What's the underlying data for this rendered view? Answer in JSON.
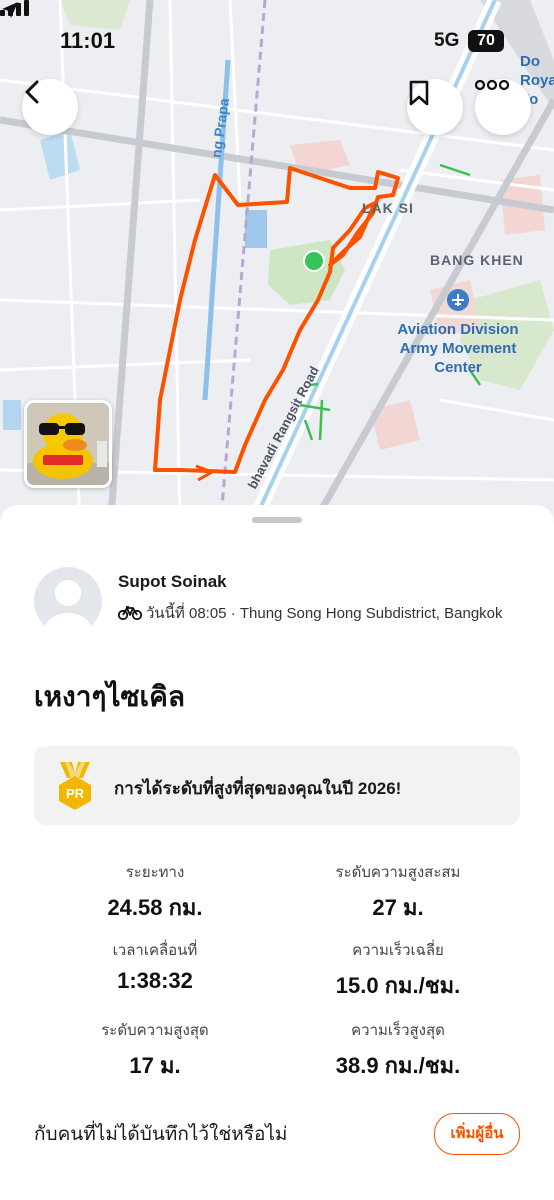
{
  "status_bar": {
    "time": "11:01",
    "network": "5G",
    "battery": "70"
  },
  "map": {
    "labels": {
      "lak_si": "LAK SI",
      "bang_khen": "BANG KHEN",
      "road_vibhavadi": "bhavadi Rangsit Road",
      "road_prem_prapa": "ng Prapa",
      "poi_aviation": "Aviation Division\nArmy Movement\nCenter",
      "poi_top_right": "Do\nRoya\nFo"
    },
    "route_color": "#fc5200"
  },
  "activity": {
    "user_name": "Supot Soinak",
    "date_location": "วันนี้ที่ 08:05 · Thung Song Hong Subdistrict, Bangkok",
    "sport_icon": "bicycle-icon",
    "title": "เหงาๆไซเคิล",
    "pr_banner": "การได้ระดับที่สูงที่สุดของคุณในปี 2026!",
    "pr_badge": "PR"
  },
  "stats": [
    {
      "label": "ระยะทาง",
      "value": "24.58 กม."
    },
    {
      "label": "ระดับความสูงสะสม",
      "value": "27 ม."
    },
    {
      "label": "เวลาเคลื่อนที่",
      "value": "1:38:32"
    },
    {
      "label": "ความเร็วเฉลี่ย",
      "value": "15.0 กม./ชม."
    },
    {
      "label": "ระดับความสูงสุด",
      "value": "17 ม."
    },
    {
      "label": "ความเร็วสูงสุด",
      "value": "38.9 กม./ชม."
    }
  ],
  "footer": {
    "prompt": "กับคนที่ไม่ได้บันทึกไว้ใช่หรือไม่",
    "add_button": "เพิ่มผู้อื่น"
  },
  "colors": {
    "accent": "#fc5200",
    "pr_gold": "#f2b705"
  }
}
